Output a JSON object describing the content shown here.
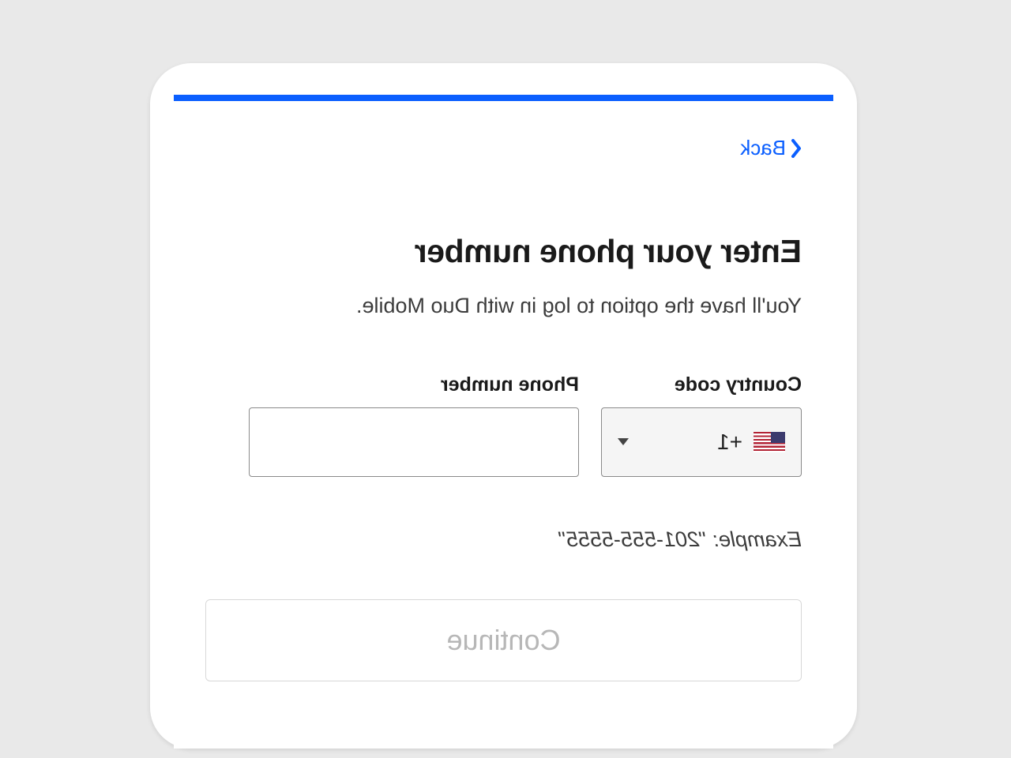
{
  "nav": {
    "back_label": "Back"
  },
  "header": {
    "title": "Enter your phone number",
    "subtitle": "You'll have the option to log in with Duo Mobile."
  },
  "form": {
    "country_code_label": "Country code",
    "phone_label": "Phone number",
    "dial_code": "+1",
    "phone_value": "",
    "example": "Example: \"201-555-5555\""
  },
  "actions": {
    "continue_label": "Continue"
  }
}
